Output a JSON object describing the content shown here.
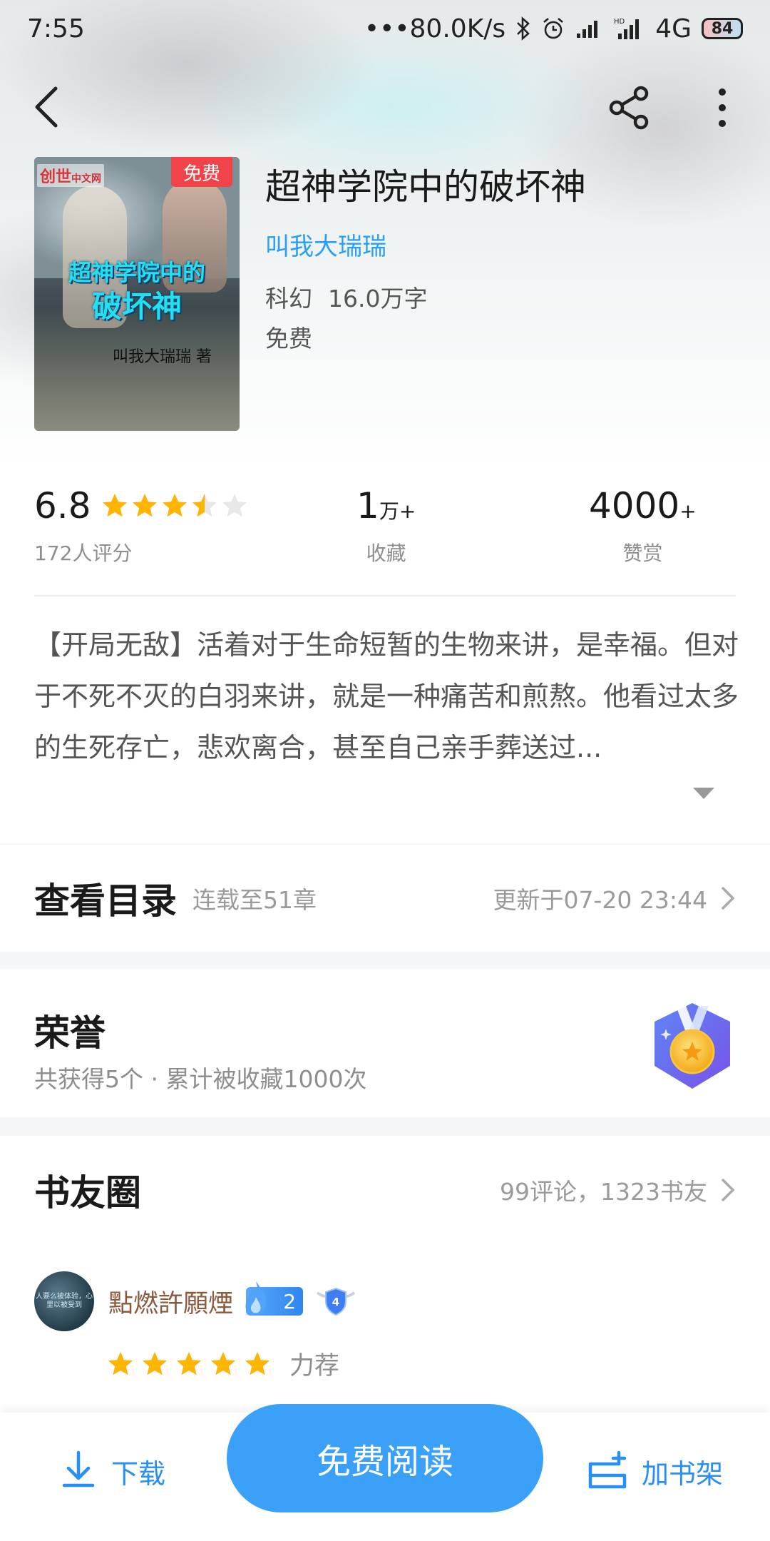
{
  "status_bar": {
    "time": "7:55",
    "net_speed": "•••80.0K/s",
    "network": "4G",
    "battery": "84"
  },
  "book": {
    "cover_badge": "免费",
    "cover_logo": "创世",
    "cover_logo_sub": "中文网",
    "cover_title_line1": "超神学院中的",
    "cover_title_line2": "破坏神",
    "cover_author": "叫我大瑞瑞 著",
    "title": "超神学院中的破坏神",
    "author": "叫我大瑞瑞",
    "genre": "科幻",
    "word_count": "16.0万字",
    "price": "免费"
  },
  "stats": {
    "rating_score": "6.8",
    "rating_stars": 3.5,
    "rating_count": "172人评分",
    "favorites_value": "1",
    "favorites_unit": "万+",
    "favorites_label": "收藏",
    "rewards_value": "4000",
    "rewards_unit": "+",
    "rewards_label": "赞赏"
  },
  "description": "【开局无敌】活着对于生命短暂的生物来讲，是幸福。但对于不死不灭的白羽来讲，就是一种痛苦和煎熬。他看过太多的生死存亡，悲欢离合，甚至自己亲手葬送过...",
  "catalog": {
    "title": "查看目录",
    "progress": "连载至51章",
    "updated": "更新于07-20 23:44"
  },
  "honors": {
    "title": "荣誉",
    "summary": "共获得5个 · 累计被收藏1000次"
  },
  "friends": {
    "title": "书友圈",
    "stat": "99评论，1323书友",
    "comment": {
      "avatar_text": "人要么被体验，心里以被受到",
      "username": "點燃許願煙",
      "fan_level": "2",
      "shield_level": "4",
      "stars": 5,
      "rating_text": "力荐"
    }
  },
  "bottom_bar": {
    "download": "下载",
    "read": "免费阅读",
    "add_shelf": "加书架"
  },
  "colors": {
    "accent": "#3aa0f8",
    "link": "#2aa0f5",
    "star": "#ffb400",
    "free_badge": "#f0444a"
  }
}
